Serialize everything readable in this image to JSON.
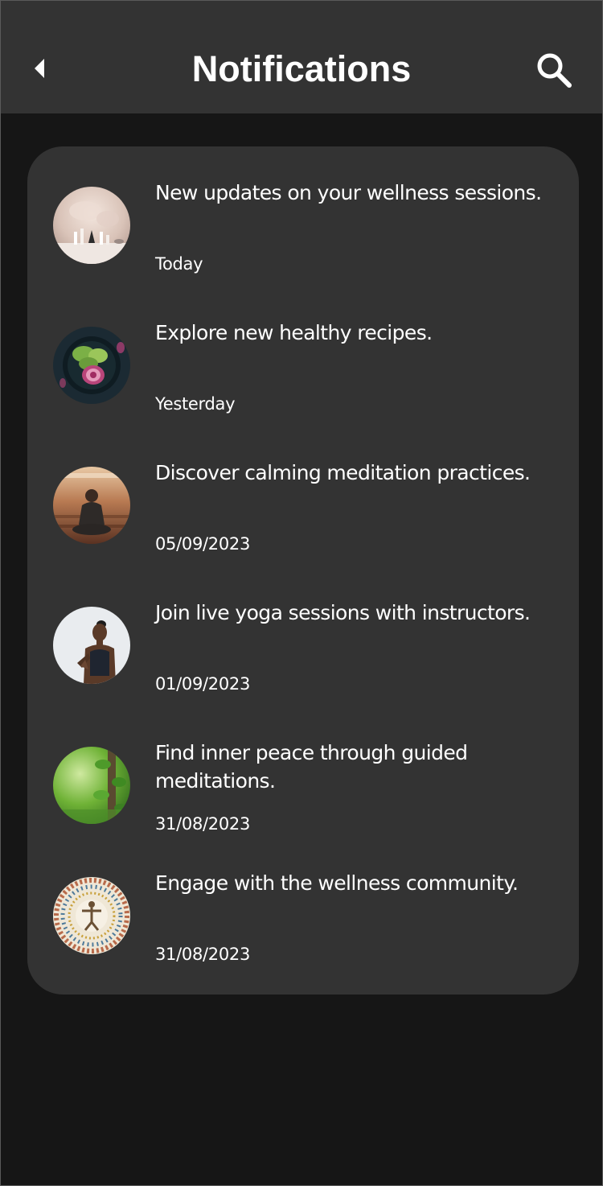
{
  "header": {
    "title": "Notifications",
    "back_icon": "back-arrow-icon",
    "search_icon": "search-icon"
  },
  "notifications": [
    {
      "message": "New updates on your wellness sessions.",
      "time": "Today",
      "image": "spa-stones-photo"
    },
    {
      "message": "Explore new healthy recipes.",
      "time": "Yesterday",
      "image": "salad-bowl-photo"
    },
    {
      "message": "Discover calming meditation practices.",
      "time": "05/09/2023",
      "image": "meditation-sunset-photo"
    },
    {
      "message": "Join live yoga sessions with instructors.",
      "time": "01/09/2023",
      "image": "yoga-instructor-photo"
    },
    {
      "message": "Find inner peace through guided meditations.",
      "time": "31/08/2023",
      "image": "green-nature-photo"
    },
    {
      "message": "Engage with the wellness community.",
      "time": "31/08/2023",
      "image": "community-circle-photo"
    }
  ],
  "colors": {
    "background": "#161616",
    "surface": "#333333",
    "text": "#ffffff"
  }
}
